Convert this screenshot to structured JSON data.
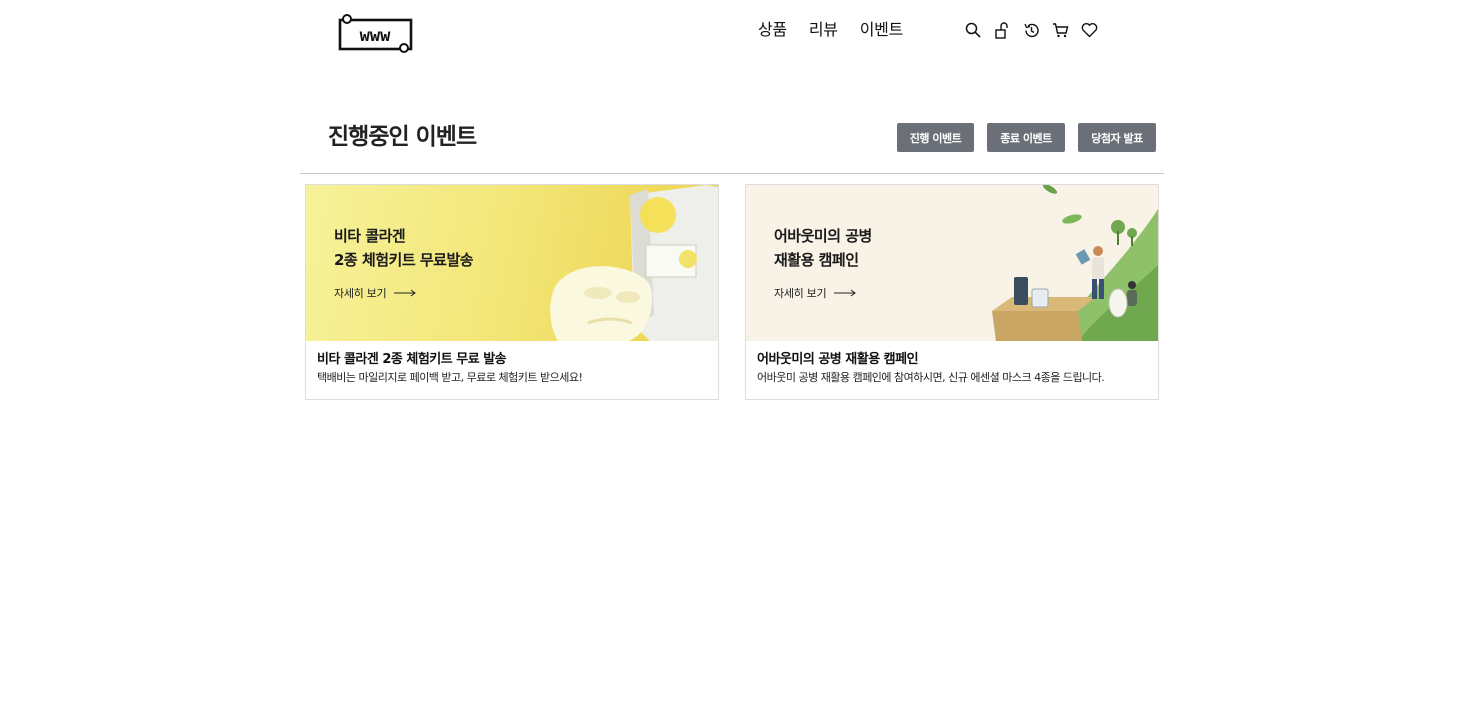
{
  "nav": {
    "items": [
      "상품",
      "리뷰",
      "이벤트"
    ]
  },
  "header_icons": [
    "search-icon",
    "lock-icon",
    "history-icon",
    "cart-icon",
    "heart-icon"
  ],
  "section": {
    "title": "진행중인 이벤트",
    "buttons": [
      "진행 이벤트",
      "종료 이벤트",
      "당첨자 발표"
    ]
  },
  "events": [
    {
      "banner_title": "비타 콜라겐\n2종 체험키트 무료발송",
      "banner_more": "자세히 보기",
      "title": "비타 콜라겐 2종 체험키트 무료 발송",
      "desc": "택배비는 마일리지로 페이백 받고, 무료로 체험키트 받으세요!"
    },
    {
      "banner_title": "어바웃미의 공병\n재활용 캠페인",
      "banner_more": "자세히 보기",
      "title": "어바웃미의 공병 재활용 캠페인",
      "desc": "어바웃미 공병 재활용 캠페인에 참여하시면, 신규 에센셜 마스크 4종을 드립니다."
    }
  ],
  "colors": {
    "button_bg": "#6b7078",
    "banner1_bg": "#f3e77a",
    "banner2_bg": "#f9f2e6",
    "divider": "#c8c8c8"
  }
}
